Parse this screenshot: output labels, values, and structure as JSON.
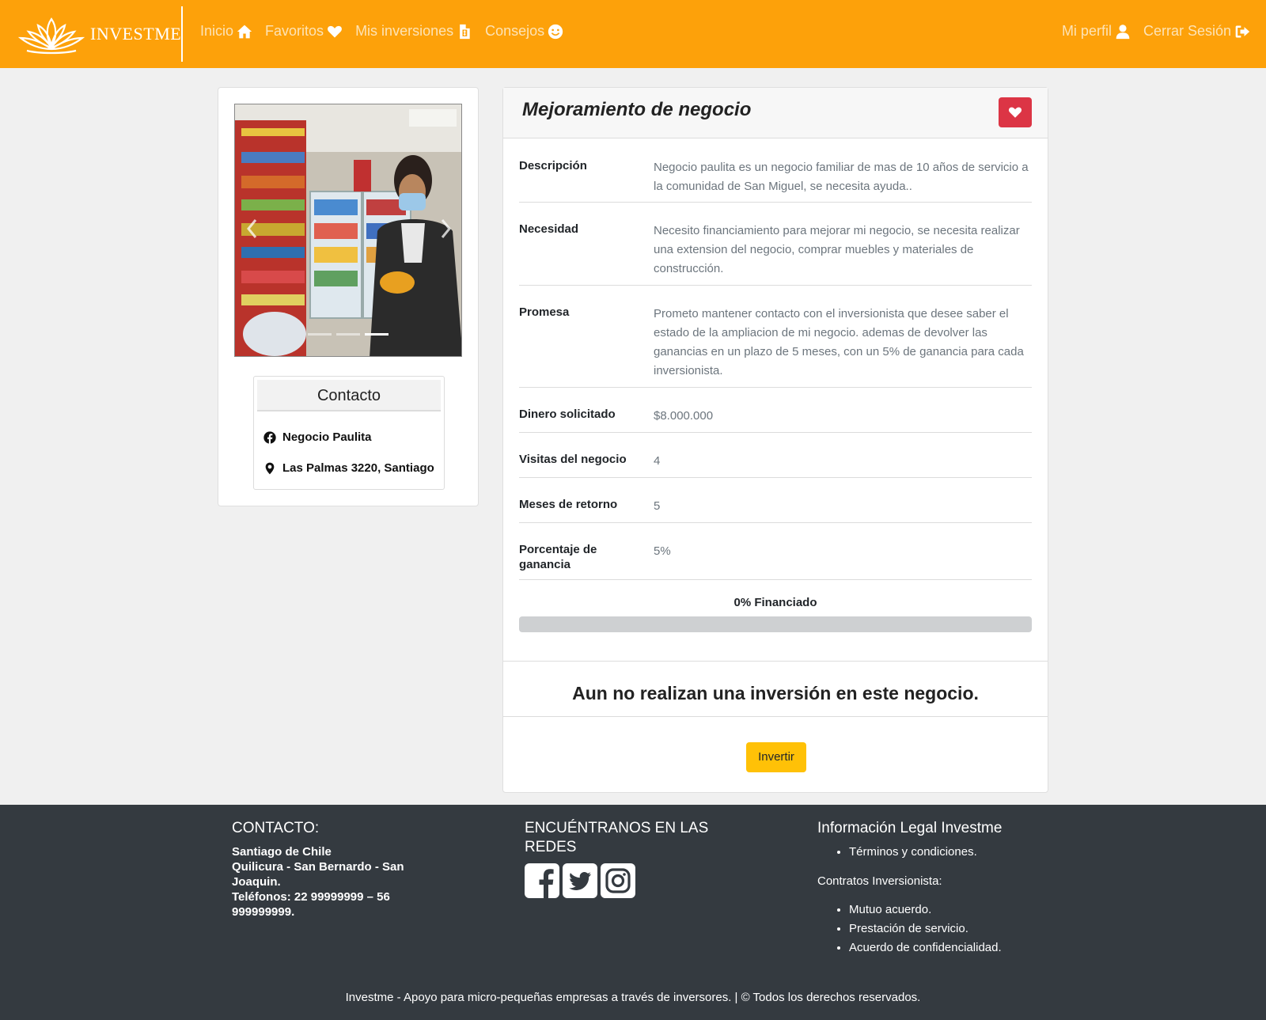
{
  "navbar": {
    "brand": "INVESTME",
    "left_links": [
      {
        "label": "Inicio",
        "icon": "home-icon"
      },
      {
        "label": "Favoritos",
        "icon": "heart-icon"
      },
      {
        "label": "Mis inversiones",
        "icon": "file-invoice-dollar-icon"
      },
      {
        "label": "Consejos",
        "icon": "smile-icon"
      }
    ],
    "right_links": [
      {
        "label": "Mi perfil",
        "icon": "user-icon"
      },
      {
        "label": "Cerrar Sesión",
        "icon": "sign-out-icon"
      }
    ]
  },
  "contact": {
    "title": "Contacto",
    "facebook": "Negocio Paulita",
    "address": "Las Palmas 3220, Santiago"
  },
  "business": {
    "title": "Mejoramiento de negocio",
    "details": [
      {
        "label": "Descripción",
        "value": "Negocio paulita es un negocio familiar de mas de 10 años de servicio a la comunidad de San Miguel, se necesita ayuda.."
      },
      {
        "label": "Necesidad",
        "value": "Necesito financiamiento para mejorar mi negocio, se necesita realizar una extension del negocio, comprar muebles y materiales de construcción."
      },
      {
        "label": "Promesa",
        "value": "Prometo mantener contacto con el inversionista que desee saber el estado de la ampliacion de mi negocio. ademas de devolver las ganancias en un plazo de 5 meses, con un 5% de ganancia para cada inversionista."
      },
      {
        "label": "Dinero solicitado",
        "value": "$8.000.000"
      },
      {
        "label": "Visitas del negocio",
        "value": "4"
      },
      {
        "label": "Meses de retorno",
        "value": "5"
      },
      {
        "label": "Porcentaje de ganancia",
        "value": "5%"
      }
    ],
    "progress_label": "0% Financiado",
    "progress_value": 0,
    "no_investment": "Aun no realizan una inversión en este negocio.",
    "invest_button": "Invertir"
  },
  "footer": {
    "contact_title": "CONTACTO:",
    "contact_lines": [
      "Santiago de Chile",
      "Quilicura - San Bernardo - San Joaquin.",
      "Teléfonos: 22 99999999 – 56 999999999."
    ],
    "social_title": "ENCUÉNTRANOS EN LAS REDES",
    "social_icons": [
      "facebook-icon",
      "twitter-icon",
      "instagram-icon"
    ],
    "legal_title": "Información Legal Investme",
    "legal_items": [
      "Términos y condiciones."
    ],
    "contracts_label": "Contratos Inversionista:",
    "contract_items": [
      "Mutuo acuerdo.",
      "Prestación de servicio.",
      "Acuerdo de confidencialidad."
    ],
    "bottom": "Investme - Apoyo para micro-pequeñas empresas a través de inversores. | © Todos los derechos reservados."
  },
  "colors": {
    "brand": "#fda10a",
    "favorite": "#dc3545",
    "invest": "#ffc107",
    "footer": "#343a40"
  }
}
